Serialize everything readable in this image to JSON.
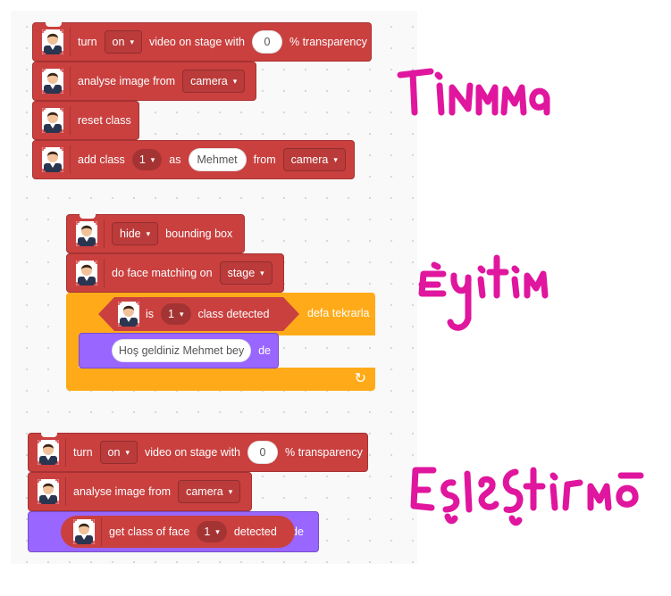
{
  "groups": {
    "g1": {
      "video": {
        "pre": "turn",
        "state": "on",
        "mid": "video on stage with",
        "transparency": "0",
        "post": "% transparency"
      },
      "analyse": {
        "label": "analyse image from",
        "source": "camera"
      },
      "reset": {
        "label": "reset class"
      },
      "add": {
        "label": "add class",
        "cls": "1",
        "as": "as",
        "name": "Mehmet",
        "from": "from",
        "source": "camera"
      }
    },
    "g2": {
      "hide": {
        "state": "hide",
        "label": "bounding box"
      },
      "match": {
        "label": "do face matching on",
        "target": "stage"
      },
      "repeat": {
        "is": "is",
        "cls": "1",
        "detected": "class detected",
        "suffix": "defa tekrarla"
      },
      "say": {
        "text": "Hoş geldiniz Mehmet bey",
        "suffix": "de"
      },
      "loop_arrow": "↻"
    },
    "g3": {
      "video": {
        "pre": "turn",
        "state": "on",
        "mid": "video on stage with",
        "transparency": "0",
        "post": "% transparency"
      },
      "analyse": {
        "label": "analyse image from",
        "source": "camera"
      },
      "get": {
        "label": "get class of face",
        "cls": "1",
        "detected": "detected",
        "suffix": "de"
      }
    }
  },
  "dropdown_arrow": "▾",
  "annotations": {
    "a1": "Tanıma",
    "a2": "Eğitim",
    "a3": "Eşleştirme"
  },
  "colors": {
    "face_block": "#c9403f",
    "looks": "#9966ff",
    "control": "#ffab19",
    "annotation": "#e0169e"
  },
  "icons": [
    "face-avatar-icon"
  ]
}
